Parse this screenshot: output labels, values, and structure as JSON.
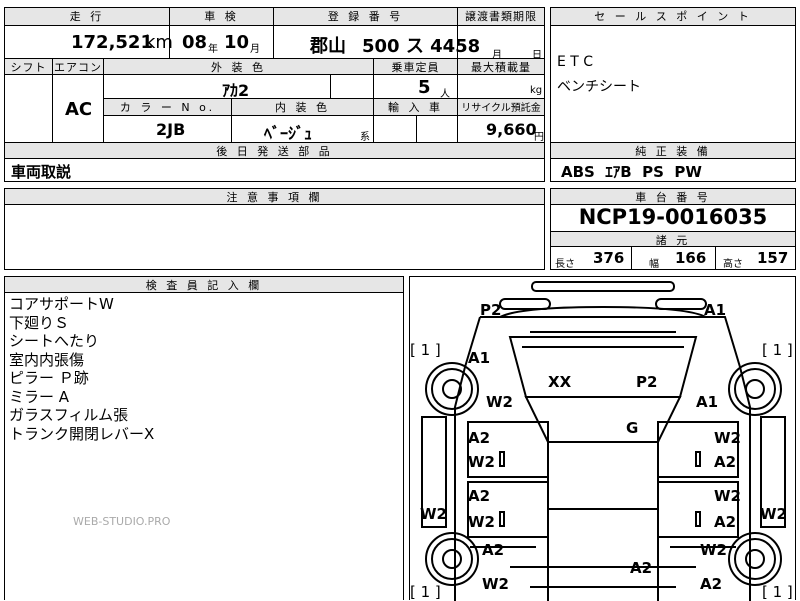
{
  "top": {
    "labels": {
      "mileage": "走 行",
      "inspection": "車 検",
      "registration": "登 録 番 号",
      "transfer_docs": "譲渡書類期限",
      "shift": "シフト",
      "aircon": "エアコン",
      "exterior_color": "外 装 色",
      "capacity": "乗車定員",
      "max_load": "最大積載量",
      "color_no": "カ ラ ー N o.",
      "interior_color": "内 装 色",
      "import": "輸 入 車",
      "recycle": "リサイクル預託金",
      "later_parts": "後 日 発 送 部 品",
      "cautions": "注 意 事 項 欄",
      "inspector": "検 査 員 記 入 欄",
      "sales_point": "セ ー ル ス ポ イ ン ト",
      "genuine": "純 正 装 備",
      "chassis_no": "車 台 番 号",
      "specs": "諸 元"
    },
    "mileage_value": "172,521",
    "mileage_unit": "km",
    "inspection_year": "08",
    "year_unit": "年",
    "inspection_month": "10",
    "month_unit": "月",
    "reg_area": "郡山",
    "reg_number": "500 ス 4458",
    "doc_month": "月",
    "doc_day": "日",
    "aircon_value": "AC",
    "exterior_value": "ｱｶ2",
    "capacity_value": "5",
    "capacity_unit": "人",
    "load_unit": "kg",
    "color_no_value": "2JB",
    "interior_value": "ﾍﾞｰｼﾞｭ",
    "interior_unit": "系",
    "recycle_value": "9,660",
    "recycle_unit": "円",
    "later_parts_value": "車両取説"
  },
  "sales_points": [
    "E T C",
    "ベンチシート"
  ],
  "genuine_equipment": "ABS  ｴｱB  PS  PW",
  "chassis_number": "NCP19-0016035",
  "specs": {
    "length_label": "長さ",
    "length": "376",
    "width_label": "幅",
    "width": "166",
    "height_label": "高さ",
    "height": "157"
  },
  "inspector_notes": [
    "コアサポートW",
    "下廻りＳ",
    "シートへたり",
    "室内内張傷",
    "ピラー Ｐ跡",
    "ミラー A",
    "ガラスフィルム張",
    "トランク開閉レバーX"
  ],
  "watermark": "WEB-STUDIO.PRO",
  "diagram": {
    "marks": {
      "p2_front": "P2",
      "a1_front_right": "A1",
      "a1_left": "A1",
      "w2_left": "W2",
      "xx": "XX",
      "p2_center": "P2",
      "a1_right": "A1",
      "g": "G",
      "a2_door_l1": "A2",
      "w2_door_l1": "W2",
      "a2_door_r1": "W2",
      "w2_door_r1": "A2",
      "a2_door_l2": "A2",
      "w2_door_l2": "W2",
      "a2_door_r2": "W2",
      "w2_door_r2": "A2",
      "w2_side_l": "W2",
      "w2_side_r": "W2",
      "a2_rear_l": "A2",
      "w2_rear_r": "W2",
      "w2_bottom_l": "W2",
      "a2_bottom_c": "A2",
      "a2_bottom_r": "A2"
    },
    "tire_labels": [
      "[ 1 ]",
      "[ 1 ]",
      "[ 1 ]",
      "[ 1 ]"
    ]
  }
}
